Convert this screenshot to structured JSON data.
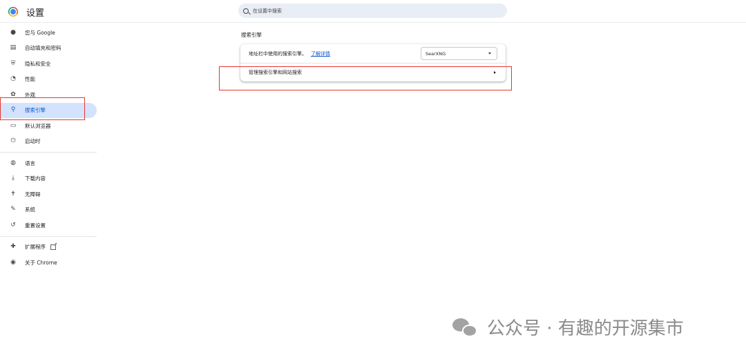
{
  "header": {
    "title": "设置",
    "search_placeholder": "在设置中搜索"
  },
  "sidebar": {
    "items": [
      {
        "label": "您与 Google",
        "icon": "person-icon"
      },
      {
        "label": "自动填充和密码",
        "icon": "clipboard-icon"
      },
      {
        "label": "隐私和安全",
        "icon": "shield-icon"
      },
      {
        "label": "性能",
        "icon": "speedometer-icon"
      },
      {
        "label": "外观",
        "icon": "palette-icon"
      },
      {
        "label": "搜索引擎",
        "icon": "search-icon",
        "active": true
      },
      {
        "label": "默认浏览器",
        "icon": "browser-icon"
      },
      {
        "label": "启动时",
        "icon": "power-icon"
      }
    ],
    "items2": [
      {
        "label": "语言",
        "icon": "globe-icon"
      },
      {
        "label": "下载内容",
        "icon": "download-icon"
      },
      {
        "label": "无障碍",
        "icon": "accessibility-icon"
      },
      {
        "label": "系统",
        "icon": "wrench-icon"
      },
      {
        "label": "重置设置",
        "icon": "reset-icon"
      }
    ],
    "items3": [
      {
        "label": "扩展程序",
        "icon": "puzzle-icon"
      },
      {
        "label": "关于 Chrome",
        "icon": "chrome-icon"
      }
    ]
  },
  "main": {
    "section_title": "搜索引擎",
    "address_bar_label": "地址栏中使用的搜索引擎。",
    "learn_more": "了解详情",
    "engine_selected": "SearXNG",
    "manage_label": "管理搜索引擎和网站搜索"
  },
  "watermark": {
    "text": "公众号 · 有趣的开源集市"
  },
  "colors": {
    "accent": "#0b57d0",
    "active_bg": "#d3e3fd",
    "highlight": "#e8352b"
  }
}
